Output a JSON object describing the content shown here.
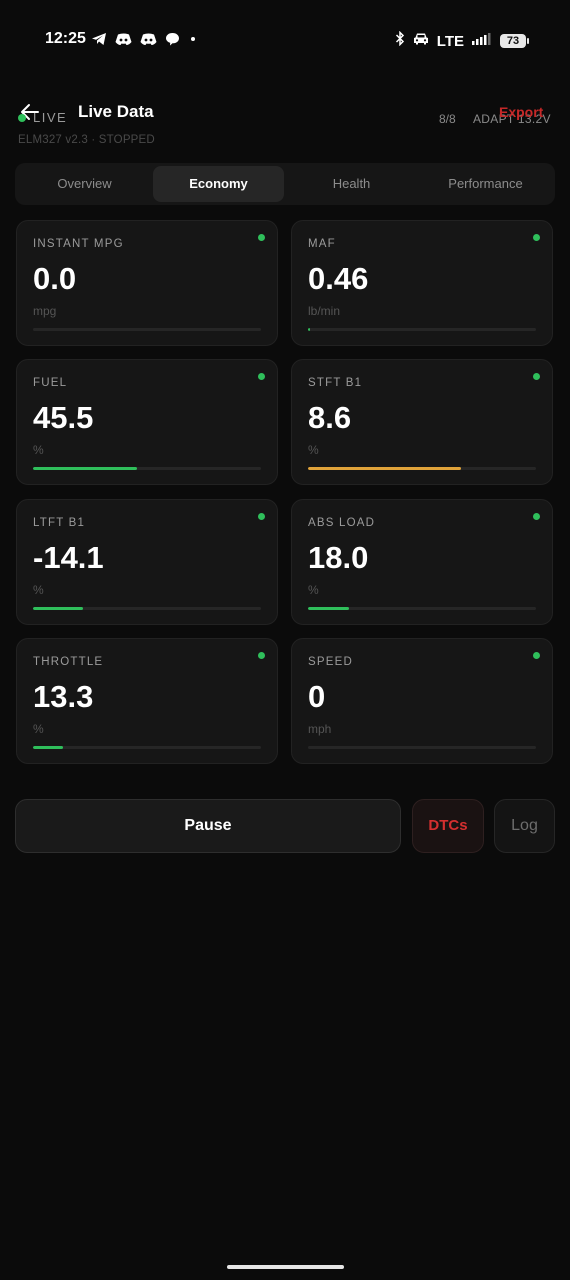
{
  "status_bar": {
    "time": "12:25",
    "network": "LTE",
    "battery": "73",
    "notification_icons": [
      "telegram-icon",
      "discord-icon",
      "discord-icon",
      "chat-bubble-icon",
      "dot-icon"
    ],
    "system_icons": [
      "bluetooth-icon",
      "car-icon",
      "signal-icon"
    ]
  },
  "header": {
    "live_label": "LIVE",
    "title": "Live Data",
    "subtitle": "ELM327 v2.3 · STOPPED",
    "count": "8/8",
    "adapter": "ADAPT 13.2V",
    "export_label": "Export"
  },
  "tabs": [
    {
      "label": "Overview",
      "active": false
    },
    {
      "label": "Economy",
      "active": true
    },
    {
      "label": "Health",
      "active": false
    },
    {
      "label": "Performance",
      "active": false
    }
  ],
  "cards": [
    {
      "label": "INSTANT MPG",
      "value": "0.0",
      "unit": "mpg",
      "progress": 0.0,
      "color": "#2fbf5b",
      "dot": true
    },
    {
      "label": "MAF",
      "value": "0.46",
      "unit": "lb/min",
      "progress": 0.01,
      "color": "#2fbf5b",
      "dot": true
    },
    {
      "label": "FUEL",
      "value": "45.5",
      "unit": "%",
      "progress": 0.455,
      "color": "#2fbf5b",
      "dot": true
    },
    {
      "label": "STFT B1",
      "value": "8.6",
      "unit": "%",
      "progress": 0.67,
      "color": "#e0a33a",
      "dot": true
    },
    {
      "label": "LTFT B1",
      "value": "-14.1",
      "unit": "%",
      "progress": 0.22,
      "color": "#2fbf5b",
      "dot": true
    },
    {
      "label": "ABS LOAD",
      "value": "18.0",
      "unit": "%",
      "progress": 0.18,
      "color": "#2fbf5b",
      "dot": true
    },
    {
      "label": "THROTTLE",
      "value": "13.3",
      "unit": "%",
      "progress": 0.133,
      "color": "#2fbf5b",
      "dot": true
    },
    {
      "label": "SPEED",
      "value": "0",
      "unit": "mph",
      "progress": 0.0,
      "color": "#2fbf5b",
      "dot": true
    }
  ],
  "actions": {
    "pause_label": "Pause",
    "dtcs_label": "DTCs",
    "log_label": "Log"
  },
  "colors": {
    "background": "#0b0b0b",
    "card": "#161616",
    "accent_green": "#2fbf5b",
    "accent_amber": "#e0a33a",
    "accent_red": "#d32f2f"
  }
}
